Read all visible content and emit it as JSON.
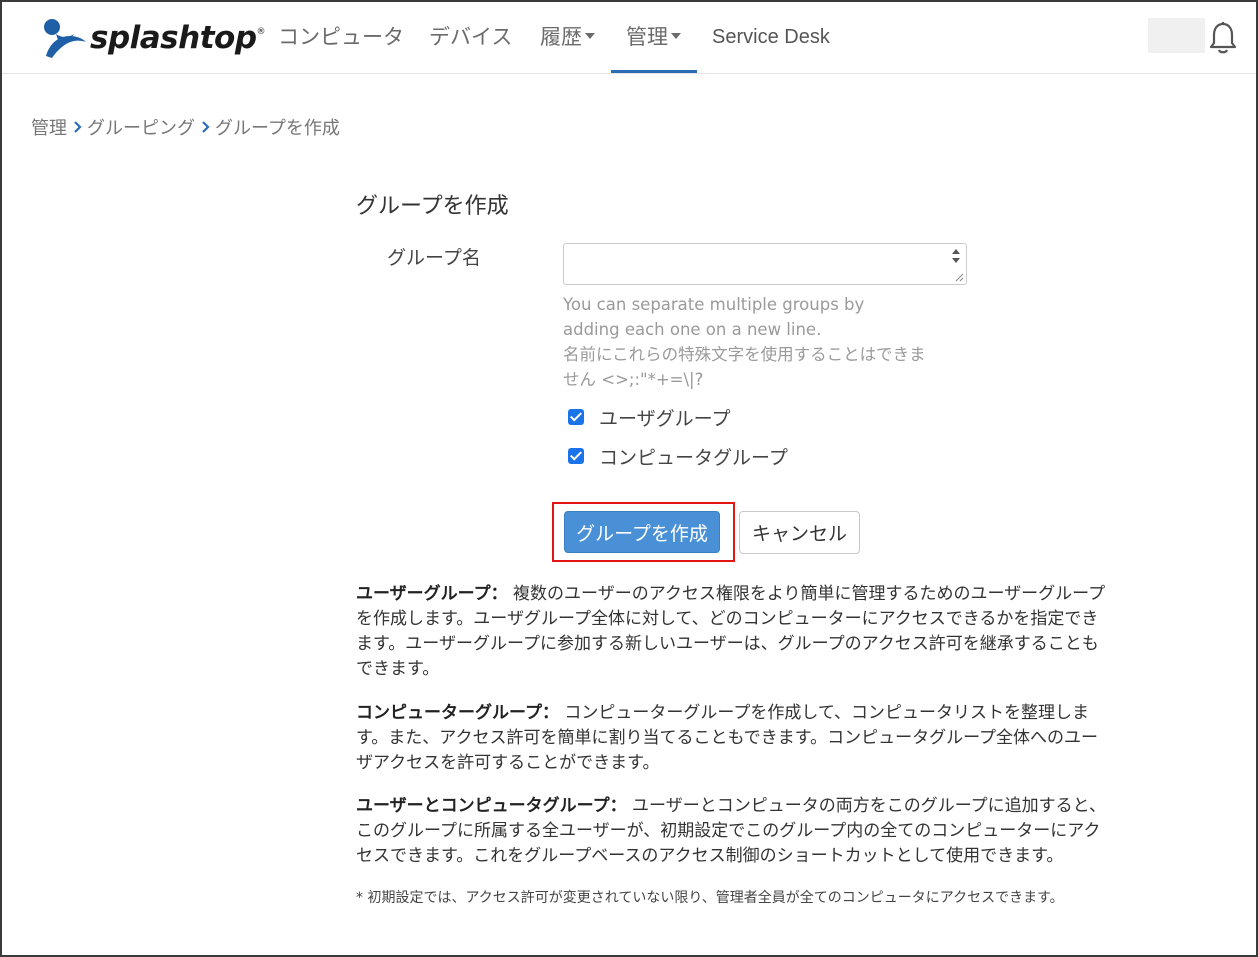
{
  "navbar": {
    "brand": "splashtop",
    "brand_mark": "®",
    "items": [
      {
        "label": "コンピュータ"
      },
      {
        "label": "デバイス"
      },
      {
        "label": "履歴"
      },
      {
        "label": "管理"
      },
      {
        "label": "Service Desk"
      }
    ],
    "active_item": "管理",
    "icons": {
      "bell": "bell-icon",
      "dropdown": "caret-down-icon"
    }
  },
  "breadcrumb": [
    "管理",
    "グルーピング",
    "グループを作成"
  ],
  "form": {
    "title": "グループを作成",
    "name_label": "グループ名",
    "name_value": "",
    "help_lines": [
      "You can separate multiple groups by",
      "adding each one on a new line.",
      "名前にこれらの特殊文字を使用することはできま",
      "せん <>;:\"*+=\\|?"
    ],
    "checkboxes": [
      {
        "label": "ユーザグループ",
        "checked": true
      },
      {
        "label": "コンピュータグループ",
        "checked": true
      }
    ],
    "submit_label": "グループを作成",
    "cancel_label": "キャンセル"
  },
  "descriptions": [
    {
      "term": "ユーザーグループ：",
      "lines": [
        " 複数のユーザーのアクセス権限をより簡単に管理するためのユーザーグループ",
        "を作成します。ユーザグループ全体に対して、どのコンピューターにアクセスできるかを指定でき",
        "ます。ユーザーグループに参加する新しいユーザーは、グループのアクセス許可を継承することも",
        "できます。"
      ]
    },
    {
      "term": "コンピューターグループ：",
      "lines": [
        " コンピューターグループを作成して、コンピュータリストを整理しま",
        "す。また、アクセス許可を簡単に割り当てることもできます。コンピュータグループ全体へのユー",
        "ザアクセスを許可することができます。"
      ]
    },
    {
      "term": "ユーザーとコンピュータグループ：",
      "lines": [
        " ユーザーとコンピュータの両方をこのグループに追加すると、",
        "このグループに所属する全ユーザーが、初期設定でこのグループ内の全てのコンピューターにアク",
        "セスできます。これをグループベースのアクセス制御のショートカットとして使用できます。"
      ]
    }
  ],
  "footnote": "* 初期設定では、アクセス許可が変更されていない限り、管理者全員が全てのコンピュータにアクセスできます。",
  "colors": {
    "accent": "#4a90d6",
    "active_underline": "#2b6cb5",
    "highlight_box": "#e11515",
    "checkbox": "#1a73e8"
  }
}
